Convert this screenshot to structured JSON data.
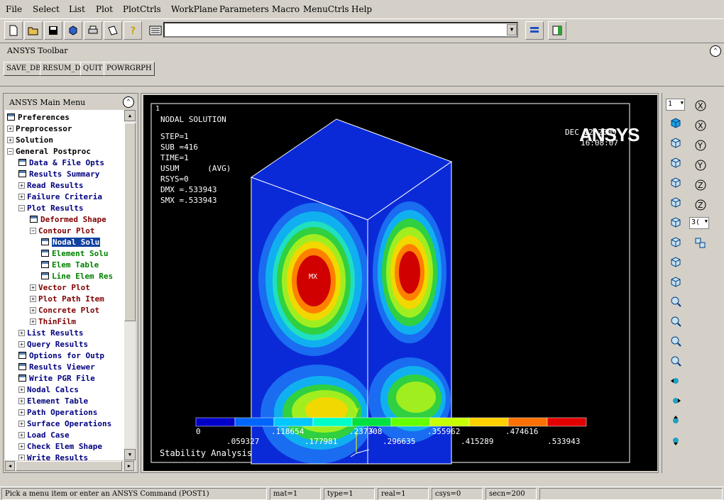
{
  "menubar": {
    "items": [
      "File",
      "Select",
      "List",
      "Plot",
      "PlotCtrls",
      "WorkPlane",
      "Parameters",
      "Macro",
      "MenuCtrls",
      "Help"
    ]
  },
  "ansys_toolbar": {
    "title": "ANSYS Toolbar",
    "buttons": [
      "SAVE_DB",
      "RESUM_DB",
      "QUIT",
      "POWRGRPH"
    ]
  },
  "main_menu": {
    "title": "ANSYS Main Menu",
    "items": [
      {
        "label": "Preferences",
        "level": 0,
        "kind": "icon",
        "color": "#000"
      },
      {
        "label": "Preprocessor",
        "level": 0,
        "kind": "plus",
        "color": "#000"
      },
      {
        "label": "Solution",
        "level": 0,
        "kind": "plus",
        "color": "#000"
      },
      {
        "label": "General Postproc",
        "level": 0,
        "kind": "minus",
        "color": "#000"
      },
      {
        "label": "Data & File Opts",
        "level": 1,
        "kind": "icon",
        "color": "#000080"
      },
      {
        "label": "Results Summary",
        "level": 1,
        "kind": "icon",
        "color": "#000080"
      },
      {
        "label": "Read Results",
        "level": 1,
        "kind": "plus",
        "color": "#000080"
      },
      {
        "label": "Failure Criteria",
        "level": 1,
        "kind": "plus",
        "color": "#000080"
      },
      {
        "label": "Plot Results",
        "level": 1,
        "kind": "minus",
        "color": "#000080"
      },
      {
        "label": "Deformed Shape",
        "level": 2,
        "kind": "icon",
        "color": "#800000"
      },
      {
        "label": "Contour Plot",
        "level": 2,
        "kind": "minus",
        "color": "#800000"
      },
      {
        "label": "Nodal Solu",
        "level": 3,
        "kind": "icon",
        "color": "#fff",
        "selected": true
      },
      {
        "label": "Element Solu",
        "level": 3,
        "kind": "icon",
        "color": "#008000"
      },
      {
        "label": "Elem Table",
        "level": 3,
        "kind": "icon",
        "color": "#008000"
      },
      {
        "label": "Line Elem Res",
        "level": 3,
        "kind": "icon",
        "color": "#008000"
      },
      {
        "label": "Vector Plot",
        "level": 2,
        "kind": "plus",
        "color": "#800000"
      },
      {
        "label": "Plot Path Item",
        "level": 2,
        "kind": "plus",
        "color": "#800000"
      },
      {
        "label": "Concrete Plot",
        "level": 2,
        "kind": "plus",
        "color": "#800000"
      },
      {
        "label": "ThinFilm",
        "level": 2,
        "kind": "plus",
        "color": "#800000"
      },
      {
        "label": "List Results",
        "level": 1,
        "kind": "plus",
        "color": "#000080"
      },
      {
        "label": "Query Results",
        "level": 1,
        "kind": "plus",
        "color": "#000080"
      },
      {
        "label": "Options for Outp",
        "level": 1,
        "kind": "icon",
        "color": "#000080"
      },
      {
        "label": "Results Viewer",
        "level": 1,
        "kind": "icon",
        "color": "#000080"
      },
      {
        "label": "Write PGR File",
        "level": 1,
        "kind": "icon",
        "color": "#000080"
      },
      {
        "label": "Nodal Calcs",
        "level": 1,
        "kind": "plus",
        "color": "#000080"
      },
      {
        "label": "Element Table",
        "level": 1,
        "kind": "plus",
        "color": "#000080"
      },
      {
        "label": "Path Operations",
        "level": 1,
        "kind": "plus",
        "color": "#000080"
      },
      {
        "label": "Surface Operations",
        "level": 1,
        "kind": "plus",
        "color": "#000080"
      },
      {
        "label": "Load Case",
        "level": 1,
        "kind": "plus",
        "color": "#000080"
      },
      {
        "label": "Check Elem Shape",
        "level": 1,
        "kind": "plus",
        "color": "#000080"
      },
      {
        "label": "Write Results",
        "level": 1,
        "kind": "plus",
        "color": "#000080"
      }
    ]
  },
  "graphics": {
    "window_number": "1",
    "info": [
      "NODAL SOLUTION",
      "STEP=1",
      "SUB =416",
      "TIME=1",
      "USUM      (AVG)",
      "RSYS=0",
      "DMX =.533943",
      "SMX =.533943"
    ],
    "logo": "ANSYS",
    "date": "DEC 12 2009",
    "time": "16:08:07",
    "max_label": "MX",
    "axis_y": "Y",
    "axis_x": "X",
    "axis_z": "Z",
    "title": "Stability Analysis",
    "legend_colors": [
      "#0000c8",
      "#0066ff",
      "#00c8ff",
      "#00ffc8",
      "#00e040",
      "#66ff00",
      "#c8ff00",
      "#ffd000",
      "#ff7000",
      "#e00000"
    ],
    "legend_top_labels": [
      "0",
      ".118654",
      ".237308",
      ".355962",
      ".474616"
    ],
    "legend_bottom_labels": [
      ".059327",
      ".177981",
      ".296635",
      ".415289",
      ".533943"
    ]
  },
  "right_toolbar": {
    "window_select": "1",
    "zoom_select": "3("
  },
  "status": {
    "prompt": "Pick a menu item or enter an ANSYS Command (POST1)",
    "mat": "mat=1",
    "type": "type=1",
    "real": "real=1",
    "csys": "csys=0",
    "secn": "secn=200"
  }
}
